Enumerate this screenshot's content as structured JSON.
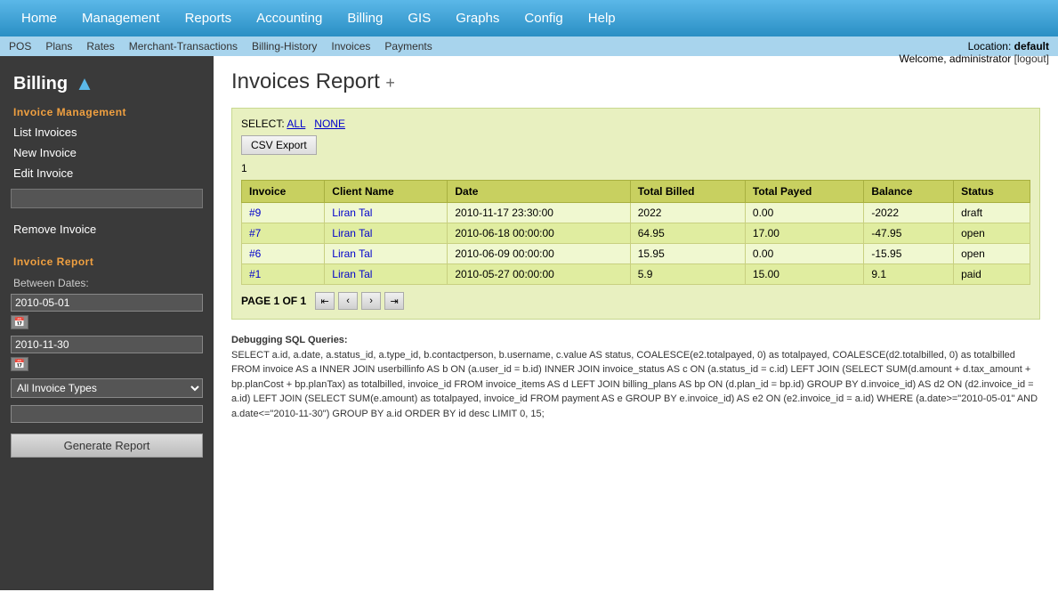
{
  "topnav": {
    "items": [
      {
        "label": "Home",
        "href": "#"
      },
      {
        "label": "Management",
        "href": "#"
      },
      {
        "label": "Reports",
        "href": "#"
      },
      {
        "label": "Accounting",
        "href": "#"
      },
      {
        "label": "Billing",
        "href": "#"
      },
      {
        "label": "GIS",
        "href": "#"
      },
      {
        "label": "Graphs",
        "href": "#"
      },
      {
        "label": "Config",
        "href": "#"
      },
      {
        "label": "Help",
        "href": "#"
      }
    ]
  },
  "subnav": {
    "items": [
      {
        "label": "POS"
      },
      {
        "label": "Plans"
      },
      {
        "label": "Rates"
      },
      {
        "label": "Merchant-Transactions"
      },
      {
        "label": "Billing-History"
      },
      {
        "label": "Invoices"
      },
      {
        "label": "Payments"
      }
    ],
    "location_label": "Location:",
    "location_value": "default",
    "welcome_text": "Welcome, administrator",
    "logout_label": "[logout]"
  },
  "sidebar": {
    "title": "Billing",
    "invoice_management_title": "Invoice Management",
    "links": [
      {
        "label": "List Invoices"
      },
      {
        "label": "New Invoice"
      },
      {
        "label": "Edit Invoice"
      }
    ],
    "remove_invoice_label": "Remove Invoice",
    "invoice_report_title": "Invoice Report",
    "between_dates_label": "Between Dates:",
    "date_start": "2010-05-01",
    "date_end": "2010-11-30",
    "invoice_type_label": "All Invoice Types",
    "generate_btn_label": "Generate Report"
  },
  "content": {
    "page_title": "Invoices Report",
    "plus_sign": "+",
    "select_label": "SELECT:",
    "all_label": "ALL",
    "none_label": "NONE",
    "csv_export_label": "CSV Export",
    "page_info": "1",
    "table": {
      "headers": [
        "Invoice",
        "Client Name",
        "Date",
        "Total Billed",
        "Total Payed",
        "Balance",
        "Status"
      ],
      "rows": [
        {
          "invoice": "#9",
          "client": "Liran Tal",
          "date": "2010-11-17 23:30:00",
          "total_billed": "2022",
          "total_payed": "0.00",
          "balance": "-2022",
          "status": "draft"
        },
        {
          "invoice": "#7",
          "client": "Liran Tal",
          "date": "2010-06-18 00:00:00",
          "total_billed": "64.95",
          "total_payed": "17.00",
          "balance": "-47.95",
          "status": "open"
        },
        {
          "invoice": "#6",
          "client": "Liran Tal",
          "date": "2010-06-09 00:00:00",
          "total_billed": "15.95",
          "total_payed": "0.00",
          "balance": "-15.95",
          "status": "open"
        },
        {
          "invoice": "#1",
          "client": "Liran Tal",
          "date": "2010-05-27 00:00:00",
          "total_billed": "5.9",
          "total_payed": "15.00",
          "balance": "9.1",
          "status": "paid"
        }
      ]
    },
    "pagination_label": "PAGE 1 OF 1",
    "debug_label": "Debugging SQL Queries:",
    "debug_sql": "SELECT a.id, a.date, a.status_id, a.type_id, b.contactperson, b.username, c.value AS status, COALESCE(e2.totalpayed, 0) as totalpayed, COALESCE(d2.totalbilled, 0) as totalbilled FROM invoice AS a INNER JOIN userbillinfo AS b ON (a.user_id = b.id) INNER JOIN invoice_status AS c ON (a.status_id = c.id) LEFT JOIN (SELECT SUM(d.amount + d.tax_amount + bp.planCost + bp.planTax) as totalbilled, invoice_id FROM invoice_items AS d LEFT JOIN billing_plans AS bp ON (d.plan_id = bp.id) GROUP BY d.invoice_id) AS d2 ON (d2.invoice_id = a.id) LEFT JOIN (SELECT SUM(e.amount) as totalpayed, invoice_id FROM payment AS e GROUP BY e.invoice_id) AS e2 ON (e2.invoice_id = a.id) WHERE (a.date>=\"2010-05-01\" AND a.date<=\"2010-11-30\") GROUP BY a.id ORDER BY id desc LIMIT 0, 15;"
  }
}
